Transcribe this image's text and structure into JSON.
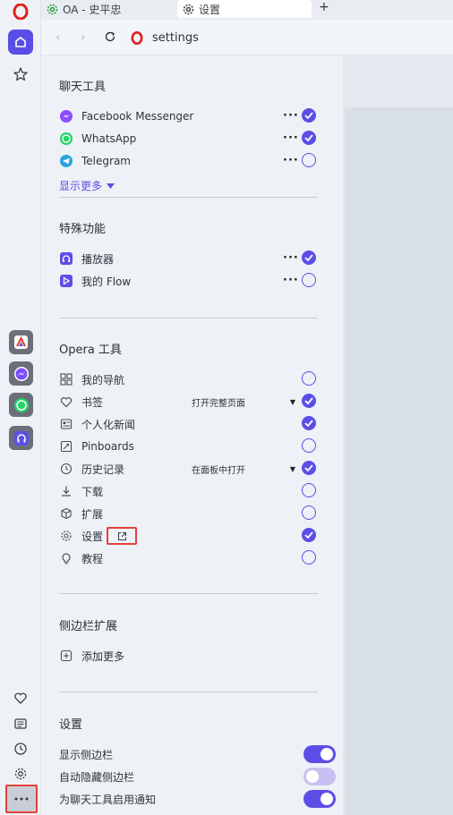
{
  "tabs": [
    {
      "label": "OA - 史平忠",
      "icon": "gear-green-icon"
    },
    {
      "label": "设置",
      "icon": "gear-icon"
    }
  ],
  "new_tab_label": "+",
  "address": {
    "text": "settings"
  },
  "colors": {
    "accent": "#5b4ee6",
    "highlight": "#e3413a"
  },
  "chat_tools": {
    "heading": "聊天工具",
    "items": [
      {
        "label": "Facebook Messenger",
        "icon": "messenger-icon",
        "enabled": true
      },
      {
        "label": "WhatsApp",
        "icon": "whatsapp-icon",
        "enabled": true
      },
      {
        "label": "Telegram",
        "icon": "telegram-icon",
        "enabled": false
      }
    ],
    "show_more": "显示更多"
  },
  "special": {
    "heading": "特殊功能",
    "items": [
      {
        "label": "播放器",
        "icon": "headphones-icon",
        "enabled": true
      },
      {
        "label": "我的 Flow",
        "icon": "flow-icon",
        "enabled": false
      }
    ]
  },
  "opera_tools": {
    "heading": "Opera 工具",
    "items": [
      {
        "label": "我的导航",
        "icon": "grid-icon",
        "enabled": false
      },
      {
        "label": "书签",
        "icon": "heart-icon",
        "enabled": true,
        "select": "打开完整页面"
      },
      {
        "label": "个人化新闻",
        "icon": "news-icon",
        "enabled": true
      },
      {
        "label": "Pinboards",
        "icon": "pinboard-icon",
        "enabled": false
      },
      {
        "label": "历史记录",
        "icon": "clock-icon",
        "enabled": true,
        "select": "在面板中打开"
      },
      {
        "label": "下载",
        "icon": "download-icon",
        "enabled": false
      },
      {
        "label": "扩展",
        "icon": "cube-icon",
        "enabled": false
      },
      {
        "label": "设置",
        "icon": "gear-icon",
        "enabled": true,
        "external": true
      },
      {
        "label": "教程",
        "icon": "bulb-icon",
        "enabled": false
      }
    ]
  },
  "sidebar_ext": {
    "heading": "侧边栏扩展",
    "add_more": "添加更多"
  },
  "settings": {
    "heading": "设置",
    "toggles": [
      {
        "label": "显示侧边栏",
        "state": "on"
      },
      {
        "label": "自动隐藏侧边栏",
        "state": "off"
      },
      {
        "label": "为聊天工具启用通知",
        "state": "on"
      }
    ]
  }
}
